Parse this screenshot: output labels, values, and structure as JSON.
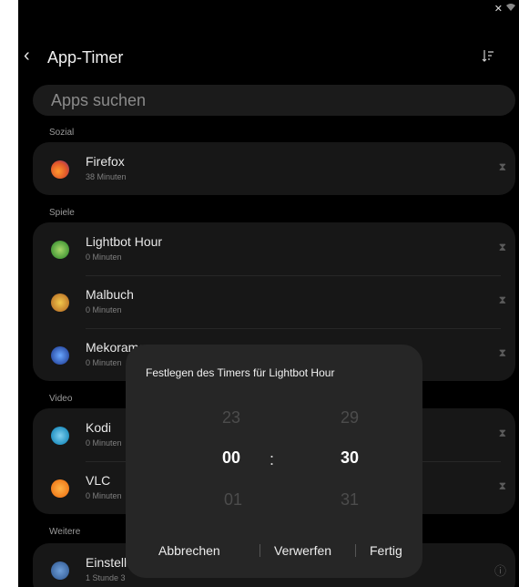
{
  "header": {
    "title": "App-Timer"
  },
  "search": {
    "placeholder": "Apps suchen"
  },
  "sections": [
    {
      "label": "Sozial",
      "apps": [
        {
          "name": "Firefox",
          "time": "38 Minuten"
        }
      ]
    },
    {
      "label": "Spiele",
      "apps": [
        {
          "name": "Lightbot Hour",
          "time": "0 Minuten"
        },
        {
          "name": "Malbuch",
          "time": "0 Minuten"
        },
        {
          "name": "Mekorama",
          "time": "0 Minuten"
        }
      ]
    },
    {
      "label": "Video",
      "apps": [
        {
          "name": "Kodi",
          "time": "0 Minuten"
        },
        {
          "name": "VLC",
          "time": "0 Minuten"
        }
      ]
    },
    {
      "label": "Weitere",
      "apps": [
        {
          "name": "Einstellungen",
          "time": "1 Stunde 3"
        }
      ]
    }
  ],
  "dialog": {
    "title": "Festlegen des Timers für Lightbot Hour",
    "hours": {
      "prev": "23",
      "current": "00",
      "next": "01"
    },
    "minutes": {
      "prev": "29",
      "current": "30",
      "next": "31"
    },
    "separator": ":",
    "cancel_label": "Abbrechen",
    "discard_label": "Verwerfen",
    "done_label": "Fertig"
  },
  "colors": {
    "background": "#000000",
    "card": "#171717",
    "dialog": "#262626"
  }
}
